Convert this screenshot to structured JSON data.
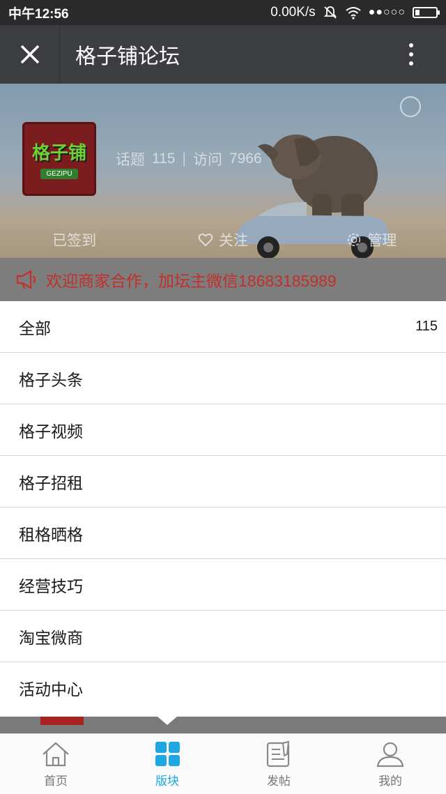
{
  "status_bar": {
    "time": "中午12:56",
    "network_speed": "0.00K/s",
    "signal_dots": "●●○○○"
  },
  "header": {
    "title": "格子铺论坛"
  },
  "forum": {
    "logo_text": "格子铺",
    "logo_subtext": "GEZIPU",
    "topics_label": "话题",
    "topics_count": "115",
    "visits_label": "访问",
    "visits_count": "7966",
    "signed_in_label": "已签到",
    "follow_label": "关注",
    "manage_label": "管理"
  },
  "notice": {
    "text": "欢迎商家合作，加坛主微信18683185989"
  },
  "sections": [
    {
      "label": "全部",
      "count": "115"
    },
    {
      "label": "格子头条",
      "count": ""
    },
    {
      "label": "格子视频",
      "count": ""
    },
    {
      "label": "格子招租",
      "count": ""
    },
    {
      "label": "租格晒格",
      "count": ""
    },
    {
      "label": "经营技巧",
      "count": ""
    },
    {
      "label": "淘宝微商",
      "count": ""
    },
    {
      "label": "活动中心",
      "count": ""
    }
  ],
  "tabbar": {
    "items": [
      {
        "label": "首页",
        "icon": "home-icon"
      },
      {
        "label": "版块",
        "icon": "grid-icon"
      },
      {
        "label": "发帖",
        "icon": "compose-icon"
      },
      {
        "label": "我的",
        "icon": "user-icon"
      }
    ],
    "active_index": 1,
    "active_color": "#1fa7e3"
  },
  "colors": {
    "titlebar": "#3b3d40",
    "notice_text": "#c1302a"
  }
}
